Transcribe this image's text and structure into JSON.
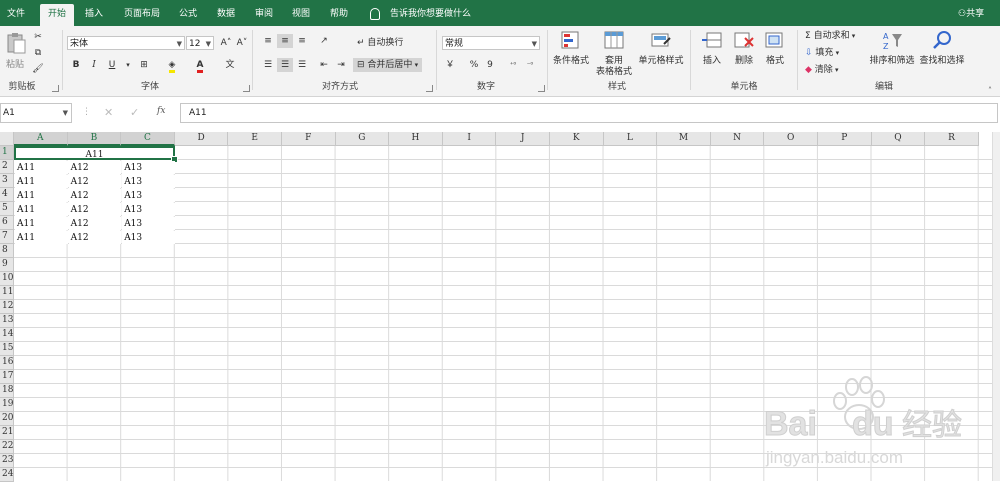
{
  "tabs": [
    "文件",
    "开始",
    "插入",
    "页面布局",
    "公式",
    "数据",
    "审阅",
    "视图",
    "帮助"
  ],
  "active_tab": "开始",
  "tell_me": "告诉我你想要做什么",
  "share": "共享",
  "clipboard": {
    "paste": "粘贴",
    "label": "剪贴板"
  },
  "font": {
    "name": "宋体",
    "size": "12",
    "label": "字体",
    "bold": "B",
    "italic": "I",
    "underline": "U",
    "grow": "A˄",
    "shrink": "A˅"
  },
  "alignment": {
    "wrap": "自动换行",
    "merge": "合并后居中",
    "label": "对齐方式"
  },
  "number": {
    "format": "常规",
    "percent": "%",
    "comma": "9",
    "label": "数字"
  },
  "styles": {
    "conditional": "条件格式",
    "as_table_1": "套用",
    "as_table_2": "表格格式",
    "cell_styles": "单元格样式",
    "label": "样式"
  },
  "cells": {
    "insert": "插入",
    "delete": "删除",
    "format": "格式",
    "label": "单元格"
  },
  "editing": {
    "autosum": "自动求和",
    "fill": "填充",
    "clear": "清除",
    "sort": "排序和筛选",
    "find": "查找和选择",
    "label": "编辑"
  },
  "formula_bar": {
    "name_box": "A1",
    "fx": "fx",
    "value": "A11"
  },
  "columns": [
    "A",
    "B",
    "C",
    "D",
    "E",
    "F",
    "G",
    "H",
    "I",
    "J",
    "K",
    "L",
    "M",
    "N",
    "O",
    "P",
    "Q",
    "R"
  ],
  "rows": [
    "1",
    "2",
    "3",
    "4",
    "5",
    "6",
    "7",
    "8",
    "9",
    "10",
    "11",
    "12",
    "13",
    "14",
    "15",
    "16",
    "17",
    "18",
    "19",
    "20",
    "21",
    "22",
    "23",
    "24"
  ],
  "merged_cell": "A11",
  "data_rows": [
    [
      "A11",
      "A12",
      "A13"
    ],
    [
      "A11",
      "A12",
      "A13"
    ],
    [
      "A11",
      "A12",
      "A13"
    ],
    [
      "A11",
      "A12",
      "A13"
    ],
    [
      "A11",
      "A12",
      "A13"
    ],
    [
      "A11",
      "A12",
      "A13"
    ]
  ],
  "watermark": {
    "brand": "Bai",
    "brand2": "du",
    "cn": "经验",
    "url": "jingyan.baidu.com"
  },
  "colors": {
    "accent": "#217346"
  }
}
